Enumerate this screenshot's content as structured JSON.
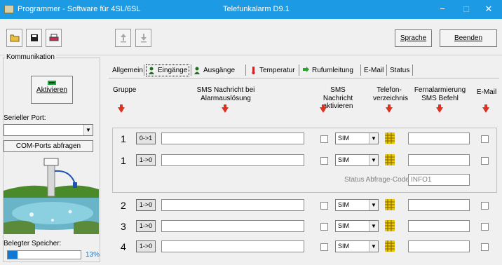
{
  "window": {
    "app_title": "Programmer - Software für 4SL/6SL",
    "doc_title": "Telefunkalarm  D9.1",
    "minimize": "−",
    "maximize": "□",
    "close": "✕"
  },
  "toolbar": {
    "sprache": "Sprache",
    "beenden": "Beenden"
  },
  "left": {
    "group_title": "Kommunikation",
    "aktivieren": "Aktivieren",
    "port_label": "Serieller Port:",
    "port_value": "",
    "com_button": "COM-Ports abfragen",
    "memory_label": "Belegter Speicher:",
    "memory_percent": "13%",
    "memory_fraction": 0.13
  },
  "tabs": [
    {
      "label": "Allgemein"
    },
    {
      "label": "Eingänge"
    },
    {
      "label": "Ausgänge"
    },
    {
      "label": "Temperatur"
    },
    {
      "label": "Rufumleitung"
    },
    {
      "label": "E-Mail"
    },
    {
      "label": "Status"
    }
  ],
  "headers": {
    "gruppe": "Gruppe",
    "sms_nachricht": "SMS Nachricht bei Alarmauslösung",
    "sms_aktivieren": "SMS Nachricht\naktivieren",
    "telefon": "Telefon-\nverzeichnis",
    "fernalarm": "Fernalarmierung\nSMS Befehl",
    "email": "E-Mail"
  },
  "status_code": {
    "label": "Status Abfrage-Code:",
    "value": "INFO1"
  },
  "rows": [
    {
      "num": "1",
      "mode": "0->1",
      "sim": "SIM"
    },
    {
      "num": "1",
      "mode": "1->0",
      "sim": "SIM"
    },
    {
      "num": "2",
      "mode": "1->0",
      "sim": "SIM"
    },
    {
      "num": "3",
      "mode": "1->0",
      "sim": "SIM"
    },
    {
      "num": "4",
      "mode": "1->0",
      "sim": "SIM"
    }
  ]
}
